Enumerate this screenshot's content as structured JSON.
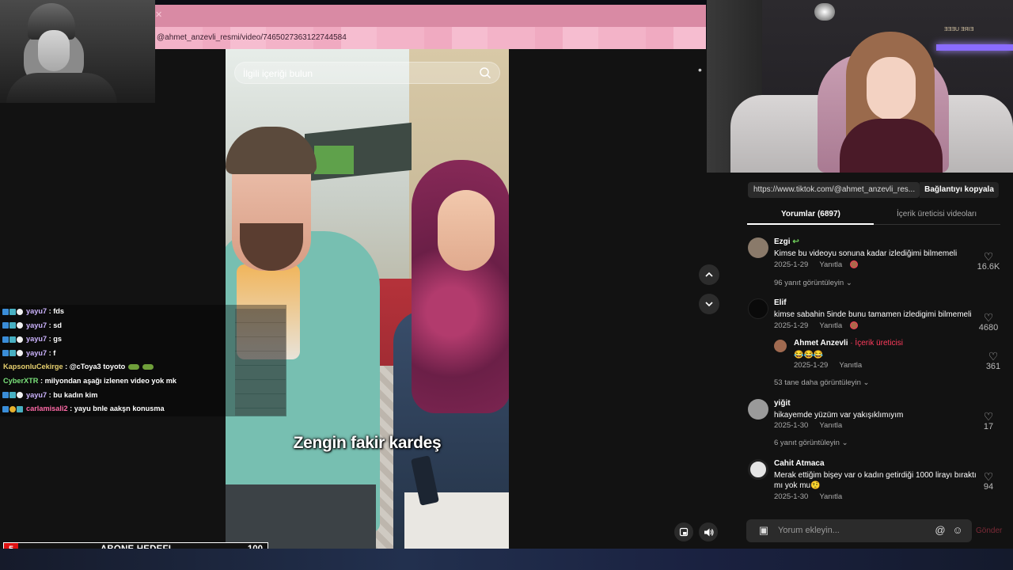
{
  "browser": {
    "close_tab": "✕",
    "url": "@ahmet_anzevli_resmi/video/7465027363122744584"
  },
  "video": {
    "search_placeholder": "İlgili içeriği bulun",
    "caption": "Zengin fakir kardeş"
  },
  "chat": {
    "messages": [
      {
        "user": "yayu7",
        "text": " : fds",
        "color": "lav"
      },
      {
        "user": "yayu7",
        "text": " : sd",
        "color": "lav"
      },
      {
        "user": "yayu7",
        "text": " : gs",
        "color": "lav"
      },
      {
        "user": "yayu7",
        "text": " : f",
        "color": "lav"
      },
      {
        "user": "KapsonluCekirge",
        "text": " : @cToya3 toyoto",
        "color": "gold"
      },
      {
        "user": "CyberXTR",
        "text": " : milyondan aşağı izlenen video yok mk",
        "color": "green"
      },
      {
        "user": "yayu7",
        "text": " : bu kadın kim",
        "color": "lav"
      },
      {
        "user": "carlamisali2",
        "text": " : yayu bnle aakşn konusma",
        "color": "pink"
      }
    ]
  },
  "goal_bar": {
    "count": "5",
    "label": "ABONE HEDEFI",
    "target": "100"
  },
  "webcam": {
    "wall_text": "ƎƎƎU ƎЯIƎ"
  },
  "share": {
    "link": "https://www.tiktok.com/@ahmet_anzevli_res...",
    "copy_label": "Bağlantıyı kopyala"
  },
  "tabs": {
    "comments": "Yorumlar (6897)",
    "creator_videos": "İçerik üreticisi videoları"
  },
  "comments": [
    {
      "name": "Ezgi",
      "text": "Kimse bu videoyu sonuna kadar izlediğimi bilmemeli",
      "date": "2025-1-29",
      "reply": "Yanıtla",
      "likes": "16.6K",
      "more": "96 yanıt görüntüleyin"
    },
    {
      "name": "Elif",
      "text": "kimse sabahin 5inde bunu tamamen izledigimi bilmemeli",
      "date": "2025-1-29",
      "reply": "Yanıtla",
      "likes": "4680"
    },
    {
      "name": "Ahmet Anzevli",
      "creator_tag": "· İçerik üreticisi",
      "text": "😂😂😂",
      "date": "2025-1-29",
      "reply": "Yanıtla",
      "likes": "361",
      "more": "53 tane daha görüntüleyin"
    },
    {
      "name": "yiğit",
      "text": "hikayemde yüzüm var yakışıklımıyım",
      "date": "2025-1-30",
      "reply": "Yanıtla",
      "likes": "17",
      "more": "6 yanıt görüntüleyin"
    },
    {
      "name": "Cahit Atmaca",
      "text": "Merak ettiğim bişey var o kadın getirdiği 1000 lirayı bıraktı mı yok mu🤨",
      "date": "2025-1-30",
      "reply": "Yanıtla",
      "likes": "94"
    }
  ],
  "composer": {
    "placeholder": "Yorum ekleyin...",
    "send_label": "Gönder"
  },
  "colors": {
    "tiktok_red": "#ff3b5c",
    "pink_bar": "#d98aa4",
    "panel_bg": "#121212"
  }
}
